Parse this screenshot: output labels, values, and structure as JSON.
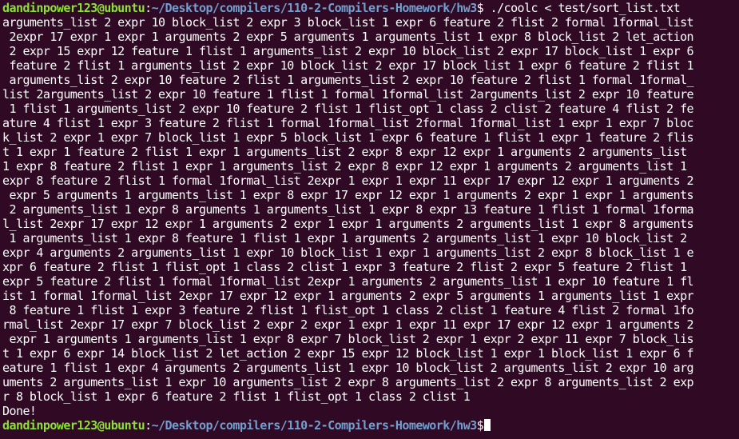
{
  "prompt1": {
    "user_host": "dandinpower123@ubuntu",
    "sep": ":",
    "path": "~/Desktop/compilers/110-2-Compilers-Homework/hw3",
    "symbol": "$",
    "command": " ./coolc < test/sort_list.txt"
  },
  "output_lines": [
    "arguments_list 2 expr 10 block_list 2 expr 3 block_list 1 expr 6 feature 2 flist 2 formal 1formal_list",
    " 2expr 17 expr 1 expr 1 arguments 2 expr 5 arguments 1 arguments_list 1 expr 8 block_list 2 let_action",
    " 2 expr 15 expr 12 feature 1 flist 1 arguments_list 2 expr 10 block_list 2 expr 17 block_list 1 expr 6",
    " feature 2 flist 1 arguments_list 2 expr 10 block_list 2 expr 17 block_list 1 expr 6 feature 2 flist 1",
    " arguments_list 2 expr 10 feature 2 flist 1 arguments_list 2 expr 10 feature 2 flist 1 formal 1formal_",
    "list 2arguments_list 2 expr 10 feature 1 flist 1 formal 1formal_list 2arguments_list 2 expr 10 feature",
    " 1 flist 1 arguments_list 2 expr 10 feature 2 flist 1 flist_opt 1 class 2 clist 2 feature 4 flist 2 fe",
    "ature 4 flist 1 expr 3 feature 2 flist 1 formal 1formal_list 2formal 1formal_list 1 expr 1 expr 7 bloc",
    "k_list 2 expr 1 expr 7 block_list 1 expr 5 block_list 1 expr 6 feature 1 flist 1 expr 1 feature 2 flis",
    "t 1 expr 1 feature 2 flist 1 expr 1 arguments_list 2 expr 8 expr 12 expr 1 arguments 2 arguments_list",
    "1 expr 8 feature 2 flist 1 expr 1 arguments_list 2 expr 8 expr 12 expr 1 arguments 2 arguments_list 1",
    "expr 8 feature 2 flist 1 formal 1formal_list 2expr 1 expr 1 expr 11 expr 17 expr 12 expr 1 arguments 2",
    " expr 5 arguments 1 arguments_list 1 expr 8 expr 17 expr 12 expr 1 arguments 2 expr 1 expr 1 arguments",
    " 2 arguments_list 1 expr 8 arguments 1 arguments_list 1 expr 8 expr 13 feature 1 flist 1 formal 1forma",
    "l_list 2expr 17 expr 12 expr 1 arguments 2 expr 1 expr 1 arguments 2 arguments_list 1 expr 8 arguments",
    " 1 arguments_list 1 expr 8 feature 1 flist 1 expr 1 arguments 2 arguments_list 1 expr 10 block_list 2",
    "expr 4 arguments 2 arguments_list 1 expr 10 block_list 1 expr 1 arguments_list 2 expr 8 block_list 1 e",
    "xpr 6 feature 2 flist 1 flist_opt 1 class 2 clist 1 expr 3 feature 2 flist 2 expr 5 feature 2 flist 1",
    "expr 5 feature 2 flist 1 formal 1formal_list 2expr 1 arguments 2 arguments_list 1 expr 10 feature 1 fl",
    "ist 1 formal 1formal_list 2expr 17 expr 12 expr 1 arguments 2 expr 5 arguments 1 arguments_list 1 expr",
    " 8 feature 1 flist 1 expr 3 feature 2 flist 1 flist_opt 1 class 2 clist 1 feature 4 flist 2 formal 1fo",
    "rmal_list 2expr 17 expr 7 block_list 2 expr 2 expr 1 expr 1 expr 11 expr 17 expr 12 expr 1 arguments 2",
    " expr 1 arguments 1 arguments_list 1 expr 8 expr 7 block_list 2 expr 1 expr 2 expr 11 expr 7 block_lis",
    "t 1 expr 6 expr 14 block_list 2 let_action 2 expr 15 expr 12 block_list 1 expr 1 block_list 1 expr 6 f",
    "eature 1 flist 1 expr 4 arguments 2 arguments_list 1 expr 10 block_list 2 arguments_list 2 expr 10 arg",
    "uments 2 arguments_list 1 expr 10 arguments_list 2 expr 8 arguments_list 2 expr 8 arguments_list 2 exp",
    "r 8 block_list 1 expr 6 feature 2 flist 1 flist_opt 1 class 2 clist 1",
    "Done!"
  ],
  "prompt2": {
    "user_host": "dandinpower123@ubuntu",
    "sep": ":",
    "path": "~/Desktop/compilers/110-2-Compilers-Homework/hw3",
    "symbol": "$"
  },
  "colors": {
    "background": "#300a24",
    "user_host": "#8ae234",
    "path": "#729fcf",
    "text": "#ffffff"
  }
}
